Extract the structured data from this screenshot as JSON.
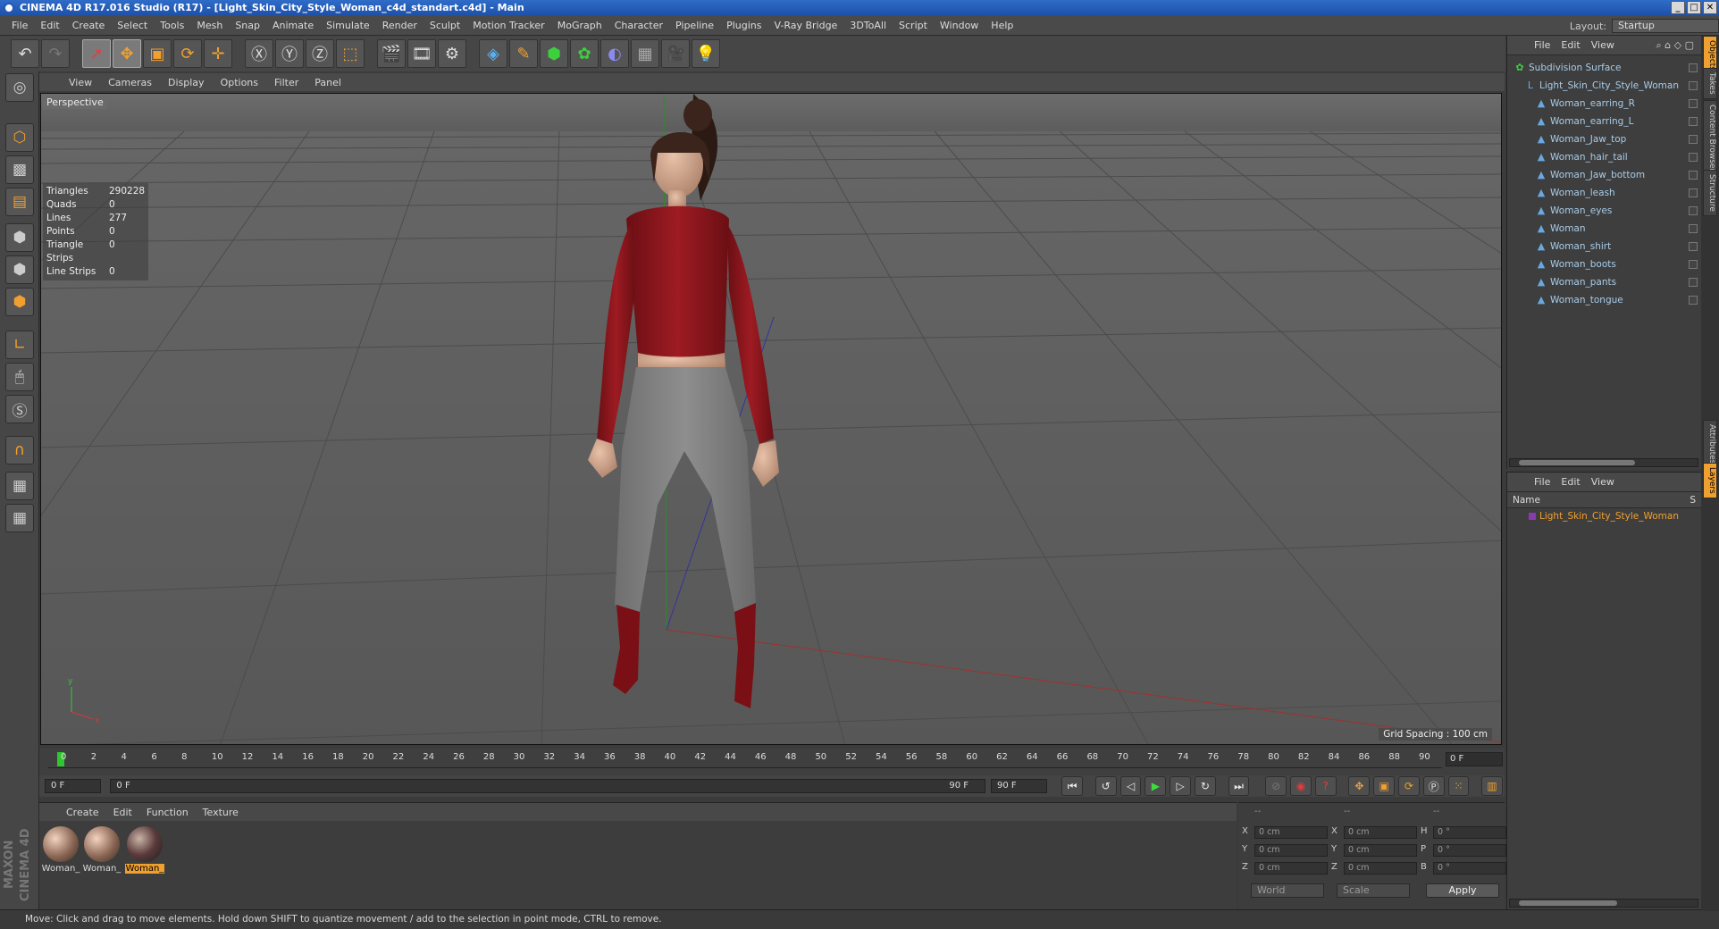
{
  "title": "CINEMA 4D R17.016 Studio (R17) - [Light_Skin_City_Style_Woman_c4d_standart.c4d] - Main",
  "menu": [
    "File",
    "Edit",
    "Create",
    "Select",
    "Tools",
    "Mesh",
    "Snap",
    "Animate",
    "Simulate",
    "Render",
    "Sculpt",
    "Motion Tracker",
    "MoGraph",
    "Character",
    "Pipeline",
    "Plugins",
    "V-Ray Bridge",
    "3DToAll",
    "Script",
    "Window",
    "Help"
  ],
  "layout": {
    "label": "Layout:",
    "value": "Startup"
  },
  "viewport": {
    "menu": [
      "View",
      "Cameras",
      "Display",
      "Options",
      "Filter",
      "Panel"
    ],
    "label": "Perspective",
    "grid_spacing": "Grid Spacing : 100 cm",
    "stats": [
      {
        "k": "Triangles",
        "v": "290228"
      },
      {
        "k": "Quads",
        "v": "0"
      },
      {
        "k": "Lines",
        "v": "277"
      },
      {
        "k": "Points",
        "v": "0"
      },
      {
        "k": "Triangle Strips",
        "v": "0"
      },
      {
        "k": "Line Strips",
        "v": "0"
      }
    ]
  },
  "timeline": {
    "ticks": [
      "0",
      "2",
      "4",
      "6",
      "8",
      "10",
      "12",
      "14",
      "16",
      "18",
      "20",
      "22",
      "24",
      "26",
      "28",
      "30",
      "32",
      "34",
      "36",
      "38",
      "40",
      "42",
      "44",
      "46",
      "48",
      "50",
      "52",
      "54",
      "56",
      "58",
      "60",
      "62",
      "64",
      "66",
      "68",
      "70",
      "72",
      "74",
      "76",
      "78",
      "80",
      "82",
      "84",
      "86",
      "88",
      "90"
    ],
    "current": "0 F",
    "start": "0 F",
    "range_start": "0 F",
    "range_end": "90 F",
    "end": "90 F"
  },
  "materials": {
    "menu": [
      "Create",
      "Edit",
      "Function",
      "Texture"
    ],
    "items": [
      {
        "label": "Woman_"
      },
      {
        "label": "Woman_"
      },
      {
        "label": "Woman_"
      }
    ]
  },
  "coords": {
    "header": [
      "--",
      "--",
      "--"
    ],
    "rows": [
      {
        "a": "X",
        "av": "0 cm",
        "b": "X",
        "bv": "0 cm",
        "c": "H",
        "cv": "0 °"
      },
      {
        "a": "Y",
        "av": "0 cm",
        "b": "Y",
        "bv": "0 cm",
        "c": "P",
        "cv": "0 °"
      },
      {
        "a": "Z",
        "av": "0 cm",
        "b": "Z",
        "bv": "0 cm",
        "c": "B",
        "cv": "0 °"
      }
    ],
    "world": "World",
    "scale": "Scale",
    "apply": "Apply"
  },
  "status": "Move: Click and drag to move elements. Hold down SHIFT to quantize movement / add to the selection in point mode, CTRL to remove.",
  "brand": "MAXON CINEMA 4D",
  "objects": {
    "menu": [
      "File",
      "Edit",
      "View"
    ],
    "items": [
      {
        "name": "Subdivision Surface",
        "indent": 0
      },
      {
        "name": "Light_Skin_City_Style_Woman",
        "indent": 1
      },
      {
        "name": "Woman_earring_R",
        "indent": 2
      },
      {
        "name": "Woman_earring_L",
        "indent": 2
      },
      {
        "name": "Woman_Jaw_top",
        "indent": 2
      },
      {
        "name": "Woman_hair_tail",
        "indent": 2
      },
      {
        "name": "Woman_Jaw_bottom",
        "indent": 2
      },
      {
        "name": "Woman_leash",
        "indent": 2
      },
      {
        "name": "Woman_eyes",
        "indent": 2
      },
      {
        "name": "Woman",
        "indent": 2
      },
      {
        "name": "Woman_shirt",
        "indent": 2
      },
      {
        "name": "Woman_boots",
        "indent": 2
      },
      {
        "name": "Woman_pants",
        "indent": 2
      },
      {
        "name": "Woman_tongue",
        "indent": 2
      }
    ]
  },
  "layers": {
    "menu": [
      "File",
      "Edit",
      "View"
    ],
    "col_name": "Name",
    "col_s": "S",
    "item": "Light_Skin_City_Style_Woman"
  },
  "sidetabs": [
    "Objects",
    "Takes",
    "Content Browser",
    "Structure",
    "Attributes",
    "Layers"
  ]
}
